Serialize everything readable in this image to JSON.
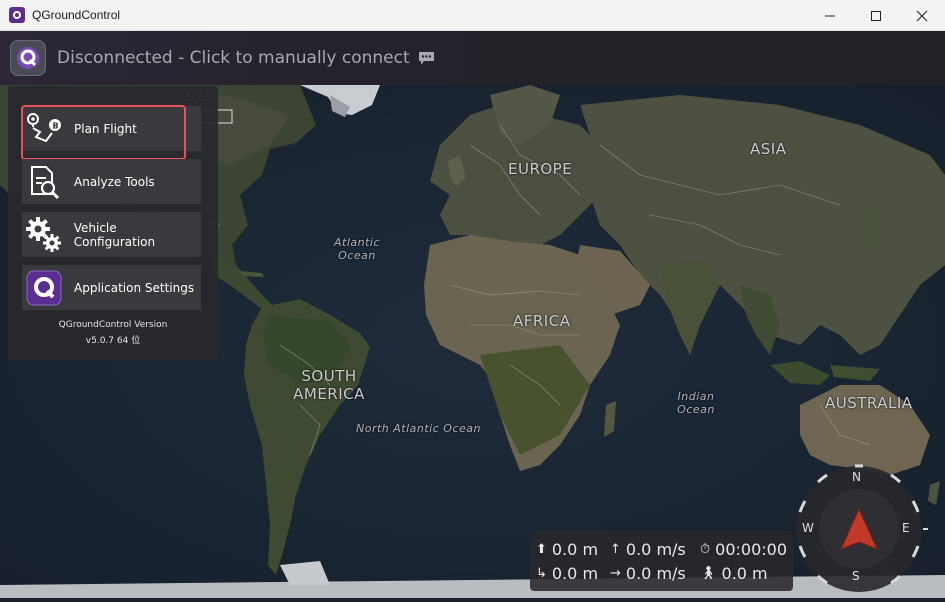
{
  "window": {
    "title": "QGroundControl",
    "controls": [
      "minimize",
      "maximize",
      "close"
    ]
  },
  "toolbar": {
    "connection_status": "Disconnected - Click to manually connect",
    "logo_icon": "qgc-logo-icon",
    "chat_icon": "chat-bubble-icon"
  },
  "map": {
    "continents": [
      "EUROPE",
      "ASIA",
      "AFRICA",
      "SOUTH AMERICA",
      "AUSTRALIA"
    ],
    "oceans": [
      "Atlantic Ocean",
      "North Atlantic Ocean",
      "Indian Ocean"
    ],
    "scale_label": "2000"
  },
  "menu": {
    "items": [
      {
        "label": "Plan Flight",
        "icon": "plan-flight-icon",
        "highlighted": true
      },
      {
        "label": "Analyze Tools",
        "icon": "analyze-tools-icon",
        "highlighted": false
      },
      {
        "label": "Vehicle Configuration",
        "icon": "vehicle-config-icon",
        "highlighted": false
      },
      {
        "label": "Application Settings",
        "icon": "app-settings-icon",
        "highlighted": false
      }
    ],
    "version_title": "QGroundControl Version",
    "version_value": "v5.0.7 64 位"
  },
  "telemetry": {
    "altitude": "0.0 m",
    "vertical_speed": "0.0 m/s",
    "flight_time": "00:00:00",
    "distance_home": "0.0 m",
    "ground_speed": "0.0 m/s",
    "distance_pilot": "0.0 m"
  },
  "compass": {
    "north": "N",
    "east": "E",
    "south": "S",
    "west": "W",
    "heading_deg": 0
  },
  "colors": {
    "accent": "#5a2d91",
    "highlight": "#e8505b",
    "compass_arrow": "#c0392b"
  }
}
